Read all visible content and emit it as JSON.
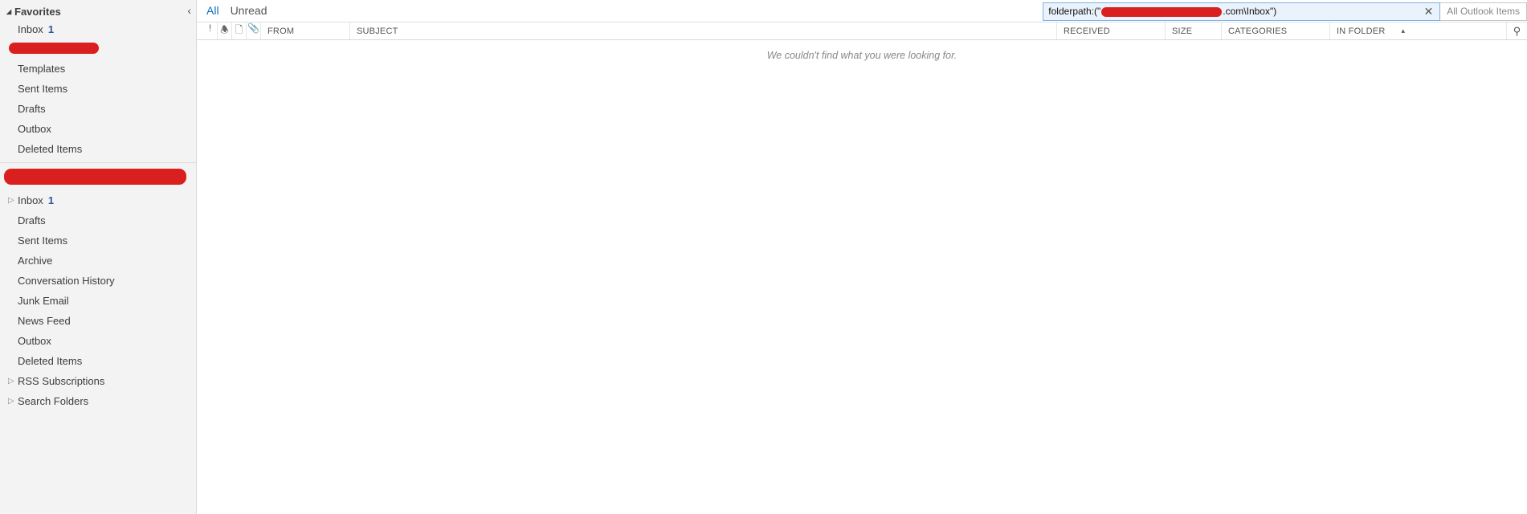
{
  "sidebar": {
    "collapse_glyph": "‹",
    "favorites_header": "Favorites",
    "favorites": [
      {
        "label": "Inbox",
        "count": "1"
      },
      {
        "redacted": true
      },
      {
        "label": "Templates"
      },
      {
        "label": "Sent Items"
      },
      {
        "label": "Drafts"
      },
      {
        "label": "Outbox"
      },
      {
        "label": "Deleted Items"
      }
    ],
    "account_header_redacted": true,
    "account_items": [
      {
        "label": "Inbox",
        "count": "1",
        "expandable": true
      },
      {
        "label": "Drafts"
      },
      {
        "label": "Sent Items"
      },
      {
        "label": "Archive"
      },
      {
        "label": "Conversation History"
      },
      {
        "label": "Junk Email"
      },
      {
        "label": "News Feed"
      },
      {
        "label": "Outbox"
      },
      {
        "label": "Deleted Items"
      },
      {
        "label": "RSS Subscriptions",
        "expandable": true
      },
      {
        "label": "Search Folders",
        "expandable": true
      }
    ]
  },
  "filters": {
    "all": "All",
    "unread": "Unread"
  },
  "search": {
    "prefix": "folderpath:(\"",
    "suffix": ".com\\Inbox\")",
    "clear_glyph": "✕",
    "scope": "All Outlook Items"
  },
  "columns": {
    "importance_glyph": "!",
    "reminder_glyph": "🕭",
    "itemtype_glyph": "🗋",
    "attachment_glyph": "📎",
    "from": "FROM",
    "subject": "SUBJECT",
    "received": "RECEIVED",
    "size": "SIZE",
    "categories": "CATEGORIES",
    "in_folder": "IN FOLDER",
    "sort_glyph": "▴",
    "filter_glyph": "⚲"
  },
  "results": {
    "empty": "We couldn't find what you were looking for."
  }
}
